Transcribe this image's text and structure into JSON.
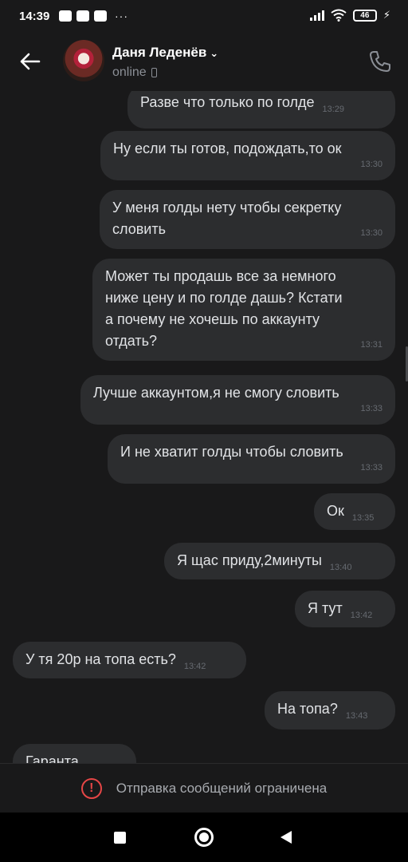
{
  "status_bar": {
    "time": "14:39",
    "battery": "46",
    "dots": "···"
  },
  "header": {
    "name": "Даня Леденёв",
    "status": "online"
  },
  "messages": [
    {
      "text": "Разве что только по голде",
      "time": "13:29"
    },
    {
      "text": "Ну если ты готов, подождать,то ок",
      "time": "13:30"
    },
    {
      "text": "У меня голды нету чтобы секретку\nсловить",
      "time": "13:30"
    },
    {
      "text": "Может ты продашь все за немного\nниже цену и по голде дашь? Кстати\nа почему не хочешь по аккаунту\nотдать?",
      "time": "13:31"
    },
    {
      "text": "Лучше аккаунтом,я не смогу словить",
      "time": "13:33"
    },
    {
      "text": "И не хватит голды чтобы словить",
      "time": "13:33"
    },
    {
      "text": "Ок",
      "time": "13:35"
    },
    {
      "text": "Я щас приду,2минуты",
      "time": "13:40"
    },
    {
      "text": "Я тут",
      "time": "13:42"
    },
    {
      "text": "У тя 20р на топа есть?",
      "time": "13:42"
    },
    {
      "text": "На топа?",
      "time": "13:43"
    },
    {
      "text": "Гаранта",
      "time": ""
    }
  ],
  "footer": {
    "text": "Отправка сообщений ограничена"
  },
  "colors": {
    "background": "#19191a",
    "bubble": "#2c2d2f",
    "warning": "#e64646"
  }
}
